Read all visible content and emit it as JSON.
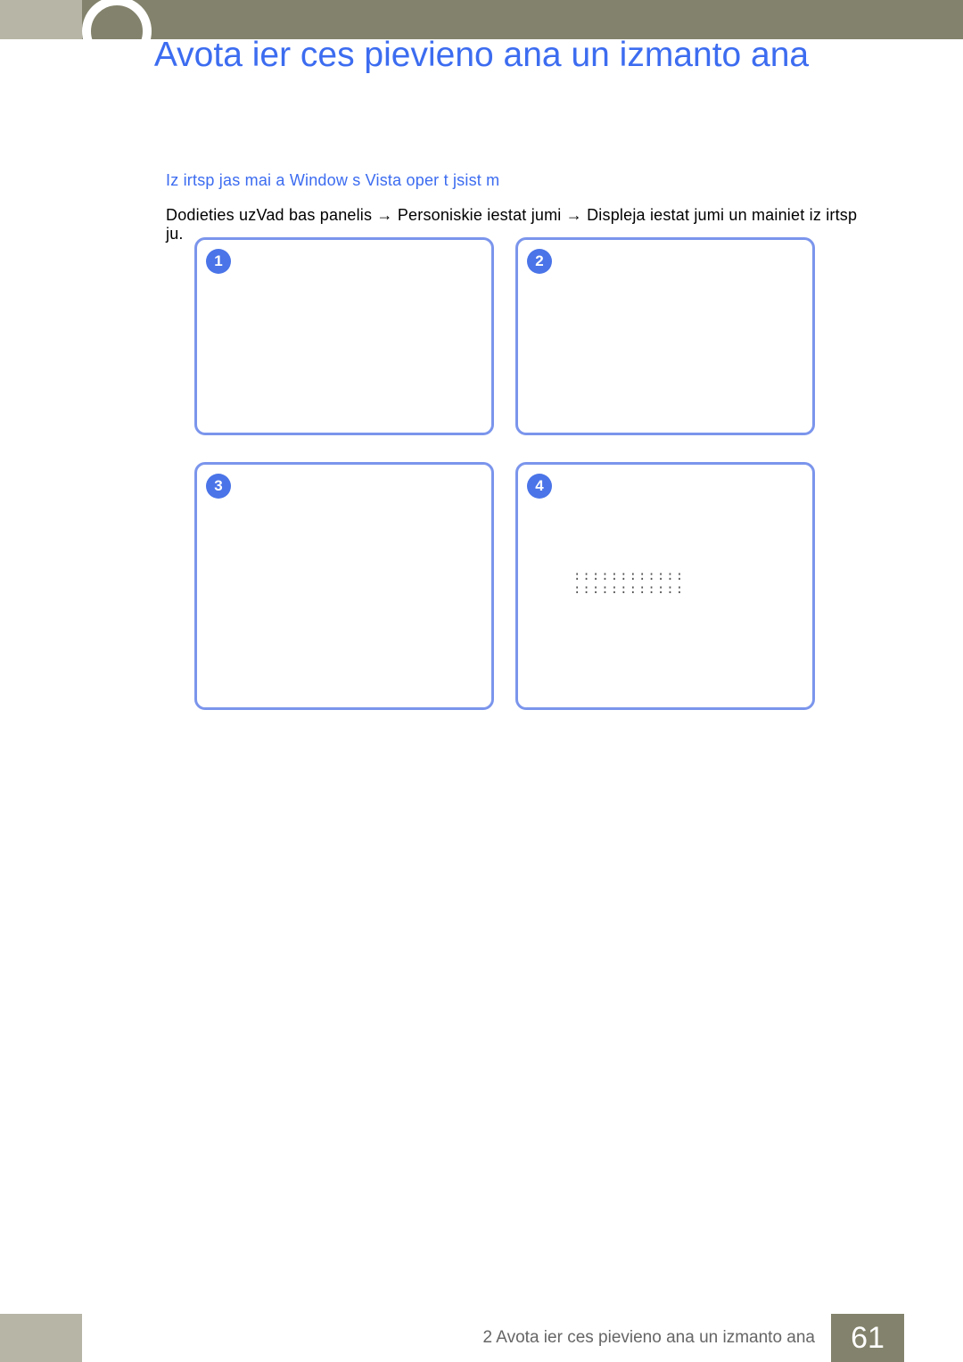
{
  "title": "Avota ier ces pievieno ana un izmanto ana",
  "subheading": "Iz  irtsp jas mai a Window  s Vista oper t jsist m",
  "body_parts": {
    "a": "Dodieties uzVad bas panelis  ",
    "arrow1": "→",
    "b": " Personiskie iestat jumi  ",
    "arrow2": "→",
    "c": " Displeja iestat jumi  un mainiet iz  irtsp ju."
  },
  "cards": [
    {
      "num": "1"
    },
    {
      "num": "2"
    },
    {
      "num": "3"
    },
    {
      "num": "4",
      "dots": "::::::::::::\n::::::::::::"
    }
  ],
  "footer": {
    "chapter": "2 Avota ier ces pievieno  ana un izmanto ana",
    "page": "61"
  }
}
